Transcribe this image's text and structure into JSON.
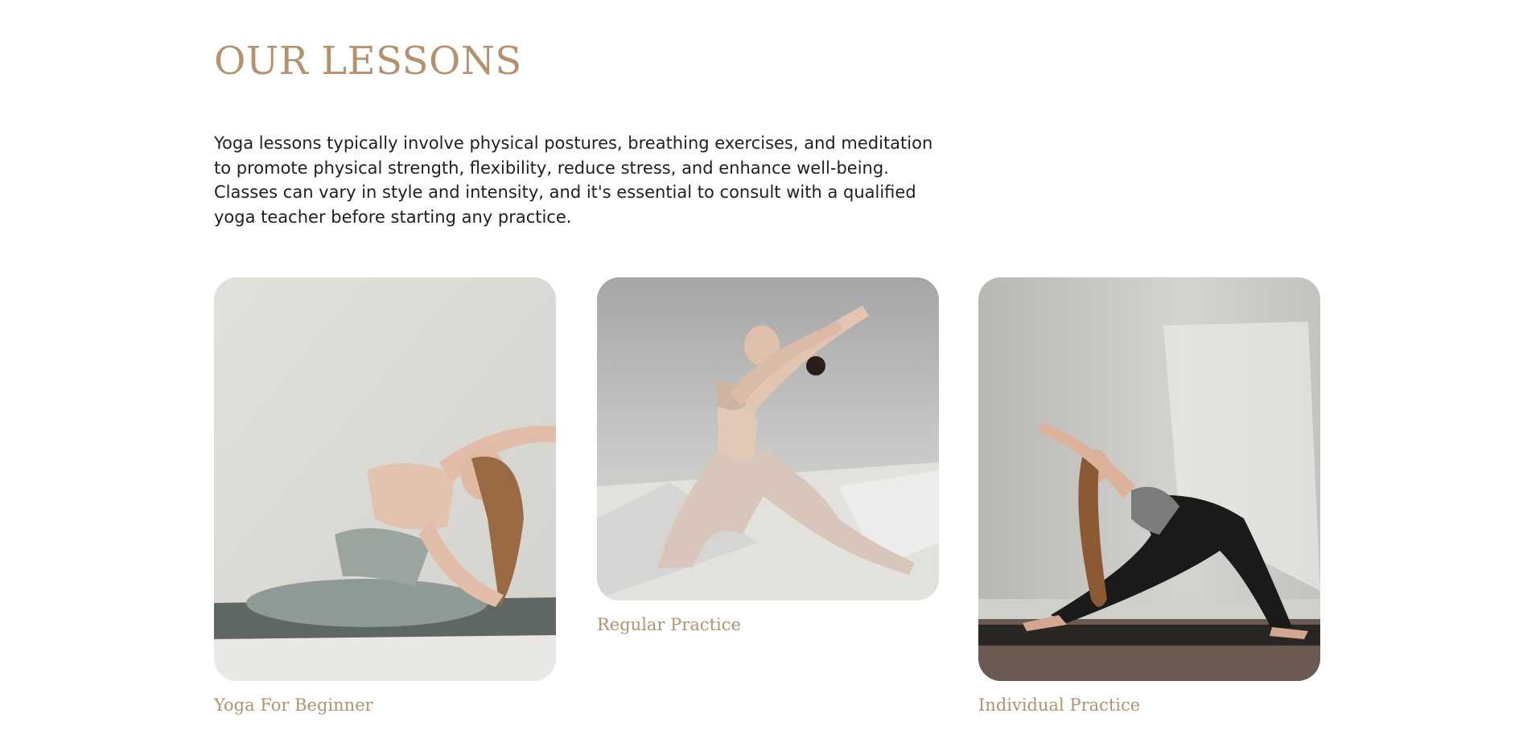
{
  "section": {
    "title": "OUR LESSONS",
    "description": "Yoga lessons typically involve physical postures, breathing exercises, and meditation to promote physical strength, flexibility, reduce stress, and enhance well-being. Classes can vary in style and intensity, and it's essential to consult with a qualified yoga teacher before starting any practice."
  },
  "lessons": [
    {
      "label": "Yoga For Beginner"
    },
    {
      "label": "Regular Practice"
    },
    {
      "label": "Individual Practice"
    }
  ],
  "colors": {
    "accent": "#b4926f",
    "text": "#1f1f1f",
    "background": "#ffffff"
  }
}
